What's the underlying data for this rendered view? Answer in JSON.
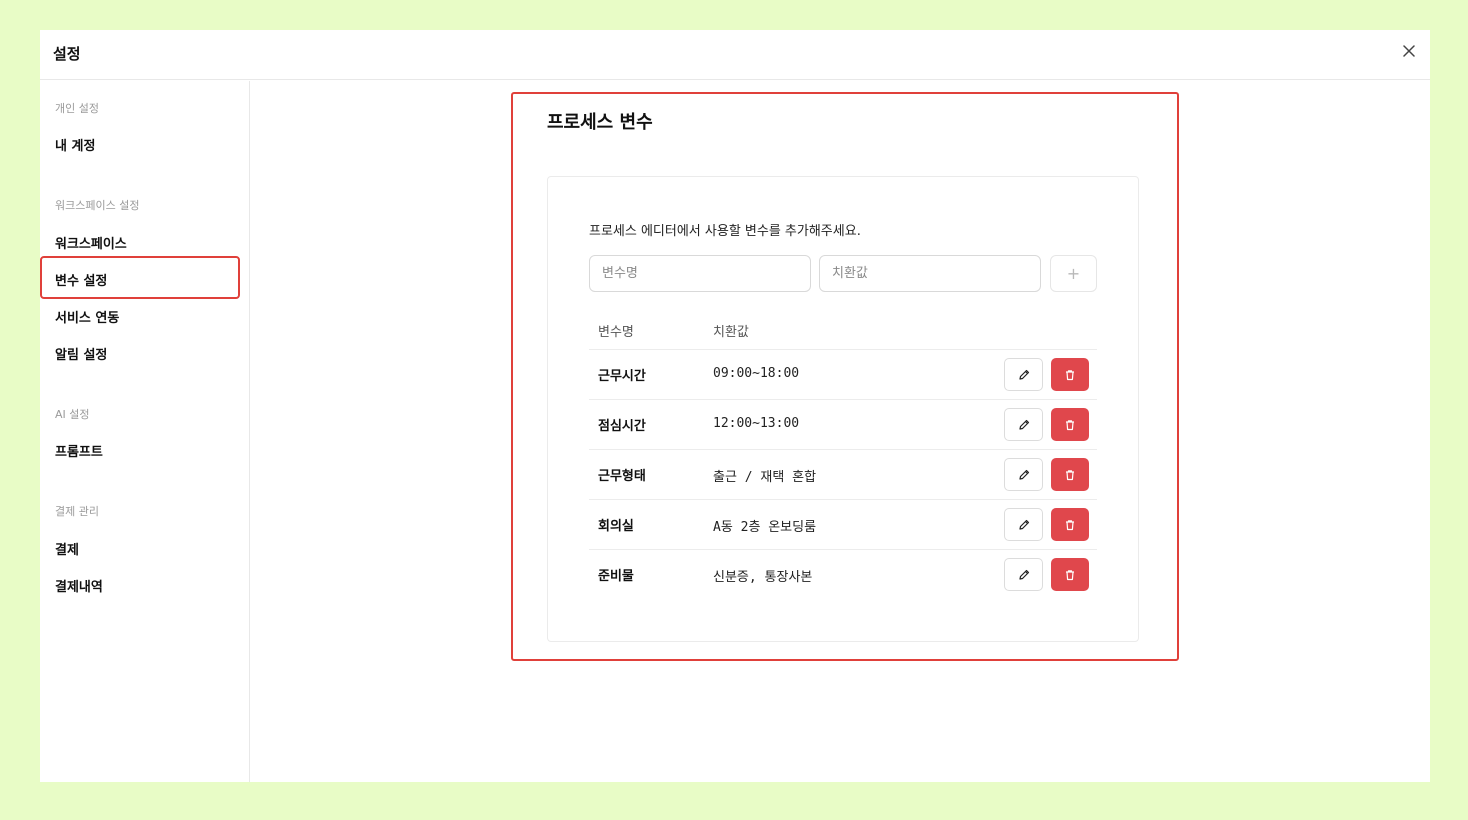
{
  "header": {
    "title": "설정"
  },
  "sidebar": {
    "groups": [
      {
        "title": "개인 설정",
        "items": [
          {
            "label": "내 계정"
          }
        ]
      },
      {
        "title": "워크스페이스 설정",
        "items": [
          {
            "label": "워크스페이스"
          },
          {
            "label": "변수 설정"
          },
          {
            "label": "서비스 연동"
          },
          {
            "label": "알림 설정"
          }
        ]
      },
      {
        "title": "AI 설정",
        "items": [
          {
            "label": "프롬프트"
          }
        ]
      },
      {
        "title": "결제 관리",
        "items": [
          {
            "label": "결제"
          },
          {
            "label": "결제내역"
          }
        ]
      }
    ],
    "active_item": "변수 설정"
  },
  "main": {
    "title": "프로세스 변수",
    "description": "프로세스 에디터에서 사용할 변수를 추가해주세요.",
    "inputs": {
      "name_placeholder": "변수명",
      "value_placeholder": "치환값",
      "add_label": "+"
    },
    "table": {
      "headers": [
        "변수명",
        "치환값"
      ],
      "rows": [
        {
          "name": "근무시간",
          "value": "09:00~18:00"
        },
        {
          "name": "점심시간",
          "value": "12:00~13:00"
        },
        {
          "name": "근무형태",
          "value": "출근 / 재택 혼합"
        },
        {
          "name": "회의실",
          "value": "A동 2층 온보딩룸"
        },
        {
          "name": "준비물",
          "value": "신분증, 통장사본"
        }
      ]
    }
  },
  "icons": {
    "close": "close-icon",
    "edit": "pencil-icon",
    "delete": "trash-icon"
  },
  "colors": {
    "highlight": "#e0403a",
    "delete_button": "#e0474c",
    "background": "#e8fcc6"
  }
}
